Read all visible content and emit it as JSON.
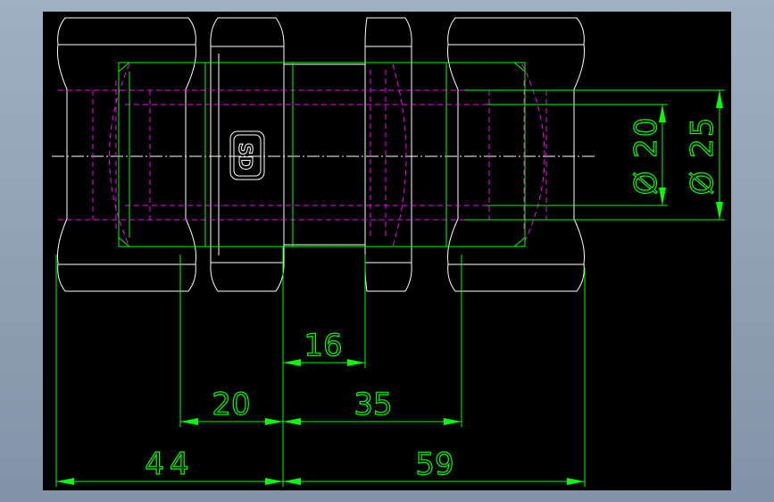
{
  "colors": {
    "background": "#000000",
    "outline": "#ffffff",
    "dimension": "#00ff00",
    "hidden": "#ff00ff",
    "centerline": "#ffffff"
  },
  "dimensions": {
    "d16": "16",
    "d20": "20",
    "d35": "35",
    "d44": "44",
    "d59": "59",
    "dia20": "Ø 20",
    "dia25": "Ø 25"
  },
  "logo_text": "SD"
}
